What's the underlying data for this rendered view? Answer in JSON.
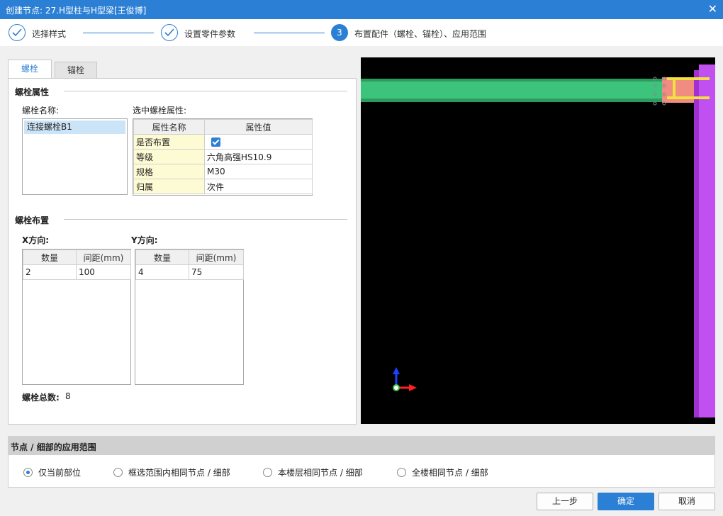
{
  "window": {
    "title": "创建节点: 27.H型柱与H型梁[王俊博]"
  },
  "steps": [
    {
      "label": "选择样式",
      "state": "done"
    },
    {
      "label": "设置零件参数",
      "state": "done"
    },
    {
      "number": "3",
      "label": "布置配件（螺栓、锚栓）、应用范围",
      "state": "active"
    }
  ],
  "tabs": [
    {
      "label": "螺栓"
    },
    {
      "label": "锚栓"
    }
  ],
  "bolt_attrs": {
    "section_title": "螺栓属性",
    "name_label": "螺栓名称:",
    "names": [
      "连接螺栓B1"
    ],
    "selected_label": "选中螺栓属性:",
    "columns": [
      "属性名称",
      "属性值"
    ],
    "rows": [
      {
        "name": "是否布置",
        "value": "",
        "checked": true
      },
      {
        "name": "等级",
        "value": "六角高强HS10.9"
      },
      {
        "name": "规格",
        "value": "M30"
      },
      {
        "name": "归属",
        "value": "次件"
      }
    ]
  },
  "bolt_layout": {
    "section_title": "螺栓布置",
    "x_label": "X方向:",
    "y_label": "Y方向:",
    "columns": [
      "数量",
      "间距(mm)"
    ],
    "x_rows": [
      {
        "count": "2",
        "spacing": "100"
      }
    ],
    "y_rows": [
      {
        "count": "4",
        "spacing": "75"
      }
    ],
    "total_label": "螺栓总数:",
    "total_value": "8"
  },
  "scope": {
    "title": "节点 / 细部的应用范围",
    "options": [
      {
        "label": "仅当前部位",
        "selected": true
      },
      {
        "label": "框选范围内相同节点 / 细部",
        "selected": false
      },
      {
        "label": "本楼层相同节点 / 细部",
        "selected": false
      },
      {
        "label": "全楼相同节点 / 细部",
        "selected": false
      }
    ]
  },
  "buttons": {
    "prev": "上一步",
    "ok": "确定",
    "cancel": "取消"
  },
  "colors": {
    "accent": "#2b7fd4",
    "beam": "#3cc47c",
    "column": "#c050f0",
    "plate": "#f08c80",
    "bolt": "#f0e040"
  }
}
